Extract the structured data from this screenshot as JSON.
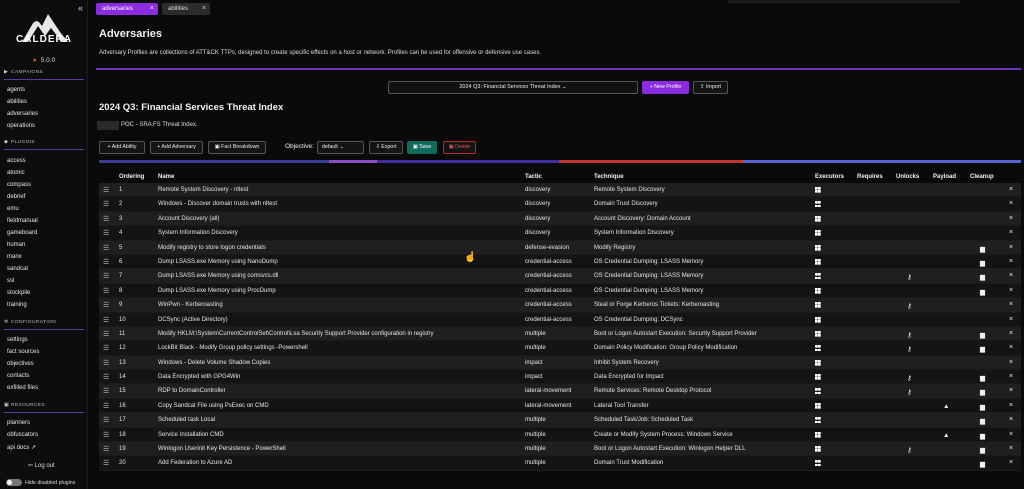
{
  "app": {
    "name": "CALDERA",
    "version": "5.0.0"
  },
  "tabs": [
    {
      "label": "adversaries"
    },
    {
      "label": "abilities"
    }
  ],
  "sidebar": {
    "campaigns": {
      "heading": "CAMPAIGNS",
      "items": [
        "agents",
        "abilities",
        "adversaries",
        "operations"
      ]
    },
    "plugins": {
      "heading": "PLUGINS",
      "items": [
        "access",
        "atomic",
        "compass",
        "debrief",
        "emu",
        "fieldmanual",
        "gameboard",
        "human",
        "manx",
        "sandcat",
        "ssl",
        "stockpile",
        "training"
      ]
    },
    "configuration": {
      "heading": "CONFIGURATION",
      "items": [
        "settings",
        "fact sources",
        "objectives",
        "contacts",
        "exfilled files"
      ]
    },
    "resources": {
      "heading": "RESOURCES",
      "items": [
        "planners",
        "obfuscators",
        "api docs ↗"
      ]
    },
    "logout": "Log out",
    "hide_disabled": "Hide disabled plugins"
  },
  "header": {
    "title": "Adversaries",
    "description": "Adversary Profiles are collections of ATT&CK TTPs, designed to create specific effects on a host or network. Profiles can be used for offensive or defensive use cases."
  },
  "selector": {
    "selected_profile": "2024 Q3: Financial Services Threat Index ⌄",
    "new_profile": "+ New Profile",
    "import": "⇪ Import"
  },
  "profile": {
    "title": "2024 Q3: Financial Services Threat Index",
    "description": "POC - SRA FS Threat Index."
  },
  "actions": {
    "add_ability": "+ Add Ability",
    "add_adversary": "+ Add Adversary",
    "fact_breakdown": "▣ Fact Breakdown",
    "objective_label": "Objective:",
    "objective_value": "default  ⌄",
    "export": "⇩ Export",
    "save": "▣ Save",
    "delete": "▣ Delete"
  },
  "tactic_bar": [
    {
      "color": "#3b3b9a",
      "weight": 230
    },
    {
      "color": "#8a4ec9",
      "weight": 48
    },
    {
      "color": "#3b2fa0",
      "weight": 182
    },
    {
      "color": "#c0362c",
      "weight": 184
    },
    {
      "color": "#5a5fd1",
      "weight": 278
    }
  ],
  "table": {
    "headers": [
      "Ordering",
      "Name",
      "Tactic",
      "Technique",
      "Executors",
      "Requires",
      "Unlocks",
      "Payload",
      "Cleanup"
    ],
    "rows": [
      {
        "order": "1",
        "name": "Remote System Discovery - nltest",
        "tactic": "discovery",
        "technique": "Remote System Discovery",
        "unlock": false,
        "payload": false,
        "cleanup": false
      },
      {
        "order": "2",
        "name": "Windows - Discover domain trusts with nltest",
        "tactic": "discovery",
        "technique": "Domain Trust Discovery",
        "unlock": false,
        "payload": false,
        "cleanup": false
      },
      {
        "order": "3",
        "name": "Account Discovery (all)",
        "tactic": "discovery",
        "technique": "Account Discovery: Domain Account",
        "unlock": false,
        "payload": false,
        "cleanup": false
      },
      {
        "order": "4",
        "name": "System Information Discovery",
        "tactic": "discovery",
        "technique": "System Information Discovery",
        "unlock": false,
        "payload": false,
        "cleanup": false
      },
      {
        "order": "5",
        "name": "Modify registry to store logon credentials",
        "tactic": "defense-evasion",
        "technique": "Modify Registry",
        "unlock": false,
        "payload": false,
        "cleanup": true
      },
      {
        "order": "6",
        "name": "Dump LSASS.exe Memory using NanoDump",
        "tactic": "credential-access",
        "technique": "OS Credential Dumping: LSASS Memory",
        "unlock": false,
        "payload": false,
        "cleanup": true
      },
      {
        "order": "7",
        "name": "Dump LSASS.exe Memory using comsvcs.dll",
        "tactic": "credential-access",
        "technique": "OS Credential Dumping: LSASS Memory",
        "unlock": true,
        "payload": false,
        "cleanup": true
      },
      {
        "order": "8",
        "name": "Dump LSASS.exe Memory using ProcDump",
        "tactic": "credential-access",
        "technique": "OS Credential Dumping: LSASS Memory",
        "unlock": false,
        "payload": false,
        "cleanup": true
      },
      {
        "order": "9",
        "name": "WinPwn - Kerberoasting",
        "tactic": "credential-access",
        "technique": "Steal or Forge Kerberos Tickets: Kerberoasting",
        "unlock": true,
        "payload": false,
        "cleanup": false
      },
      {
        "order": "10",
        "name": "DCSync (Active Directory)",
        "tactic": "credential-access",
        "technique": "OS Credential Dumping: DCSync",
        "unlock": false,
        "payload": false,
        "cleanup": false
      },
      {
        "order": "11",
        "name": "Modify HKLM:\\System\\CurrentControlSet\\Control\\Lsa Security Support Provider configuration in registry",
        "tactic": "multiple",
        "technique": "Boot or Logon Autostart Execution: Security Support Provider",
        "unlock": true,
        "payload": false,
        "cleanup": true
      },
      {
        "order": "12",
        "name": "LockBit Black - Modify Group policy settings -Powershell",
        "tactic": "multiple",
        "technique": "Domain Policy Modification: Group Policy Modification",
        "unlock": true,
        "payload": false,
        "cleanup": true
      },
      {
        "order": "13",
        "name": "Windows - Delete Volume Shadow Copies",
        "tactic": "impact",
        "technique": "Inhibit System Recovery",
        "unlock": false,
        "payload": false,
        "cleanup": false
      },
      {
        "order": "14",
        "name": "Data Encrypted with GPG4Win",
        "tactic": "impact",
        "technique": "Data Encrypted for Impact",
        "unlock": true,
        "payload": false,
        "cleanup": true
      },
      {
        "order": "15",
        "name": "RDP to DomainController",
        "tactic": "lateral-movement",
        "technique": "Remote Services: Remote Desktop Protocol",
        "unlock": true,
        "payload": false,
        "cleanup": true
      },
      {
        "order": "16",
        "name": "Copy Sandcat File using PsExec on CMD",
        "tactic": "lateral-movement",
        "technique": "Lateral Tool Transfer",
        "unlock": false,
        "payload": true,
        "cleanup": true
      },
      {
        "order": "17",
        "name": "Scheduled task Local",
        "tactic": "multiple",
        "technique": "Scheduled Task/Job: Scheduled Task",
        "unlock": false,
        "payload": false,
        "cleanup": true
      },
      {
        "order": "18",
        "name": "Service Installation CMD",
        "tactic": "multiple",
        "technique": "Create or Modify System Process: Windows Service",
        "unlock": false,
        "payload": true,
        "cleanup": true
      },
      {
        "order": "19",
        "name": "Winlogon Userinit Key Persistence - PowerShell",
        "tactic": "multiple",
        "technique": "Boot or Logon Autostart Execution: Winlogon Helper DLL",
        "unlock": true,
        "payload": false,
        "cleanup": true
      },
      {
        "order": "20",
        "name": "Add Federation to Azure AD",
        "tactic": "multiple",
        "technique": "Domain Trust Modification",
        "unlock": false,
        "payload": false,
        "cleanup": true
      }
    ]
  },
  "icons": {
    "drag": "☰",
    "remove": "×",
    "key": "🔑",
    "payload": "▲",
    "trash": "🗑",
    "windows": "windows-icon"
  }
}
